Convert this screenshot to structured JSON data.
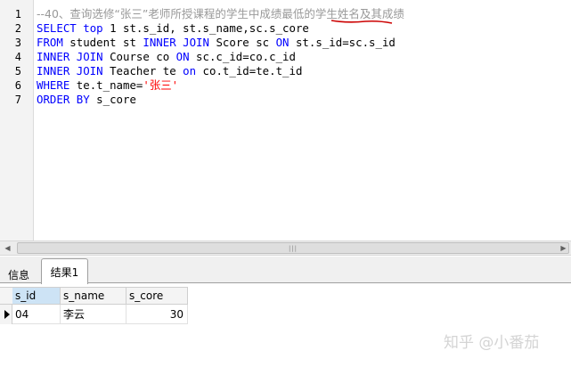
{
  "editor": {
    "lines": [
      {
        "num": "1",
        "tokens": [
          {
            "t": "--40、查询选修“张三”老师所授课程的学生中成绩最低的学生姓名及其成绩",
            "c": "cmt"
          }
        ]
      },
      {
        "num": "2",
        "tokens": [
          {
            "t": "SELECT",
            "c": "kw"
          },
          {
            "t": " "
          },
          {
            "t": "top",
            "c": "kw"
          },
          {
            "t": " 1 st.s_id, st.s_name,sc.s_core"
          }
        ]
      },
      {
        "num": "3",
        "tokens": [
          {
            "t": "FROM",
            "c": "kw"
          },
          {
            "t": " student st "
          },
          {
            "t": "INNER JOIN",
            "c": "kw"
          },
          {
            "t": " Score sc "
          },
          {
            "t": "ON",
            "c": "kw"
          },
          {
            "t": " st.s_id=sc.s_id"
          }
        ]
      },
      {
        "num": "4",
        "tokens": [
          {
            "t": "INNER JOIN",
            "c": "kw"
          },
          {
            "t": " Course co "
          },
          {
            "t": "ON",
            "c": "kw"
          },
          {
            "t": " sc.c_id=co.c_id"
          }
        ]
      },
      {
        "num": "5",
        "tokens": [
          {
            "t": "INNER JOIN",
            "c": "kw"
          },
          {
            "t": " Teacher te "
          },
          {
            "t": "on",
            "c": "kw"
          },
          {
            "t": " co.t_id=te.t_id"
          }
        ]
      },
      {
        "num": "6",
        "tokens": [
          {
            "t": "WHERE",
            "c": "kw"
          },
          {
            "t": " te.t_name="
          },
          {
            "t": "'张三'",
            "c": "str"
          }
        ]
      },
      {
        "num": "7",
        "tokens": [
          {
            "t": "ORDER BY",
            "c": "kw"
          },
          {
            "t": " s_core"
          }
        ]
      }
    ]
  },
  "scrollbar": {
    "left_arrow": "◀",
    "right_arrow": "▶",
    "grip": "|||"
  },
  "tabs": {
    "info": "信息",
    "result": "结果1"
  },
  "grid": {
    "columns": [
      "s_id",
      "s_name",
      "s_core"
    ],
    "rows": [
      [
        "04",
        "李云",
        "30"
      ]
    ]
  },
  "watermark": "知乎 @小番茄",
  "colors": {
    "keyword": "#0000ff",
    "string": "#ff0000",
    "comment": "#999999",
    "annotation": "#cc0000",
    "selected_header": "#cde3f5"
  }
}
